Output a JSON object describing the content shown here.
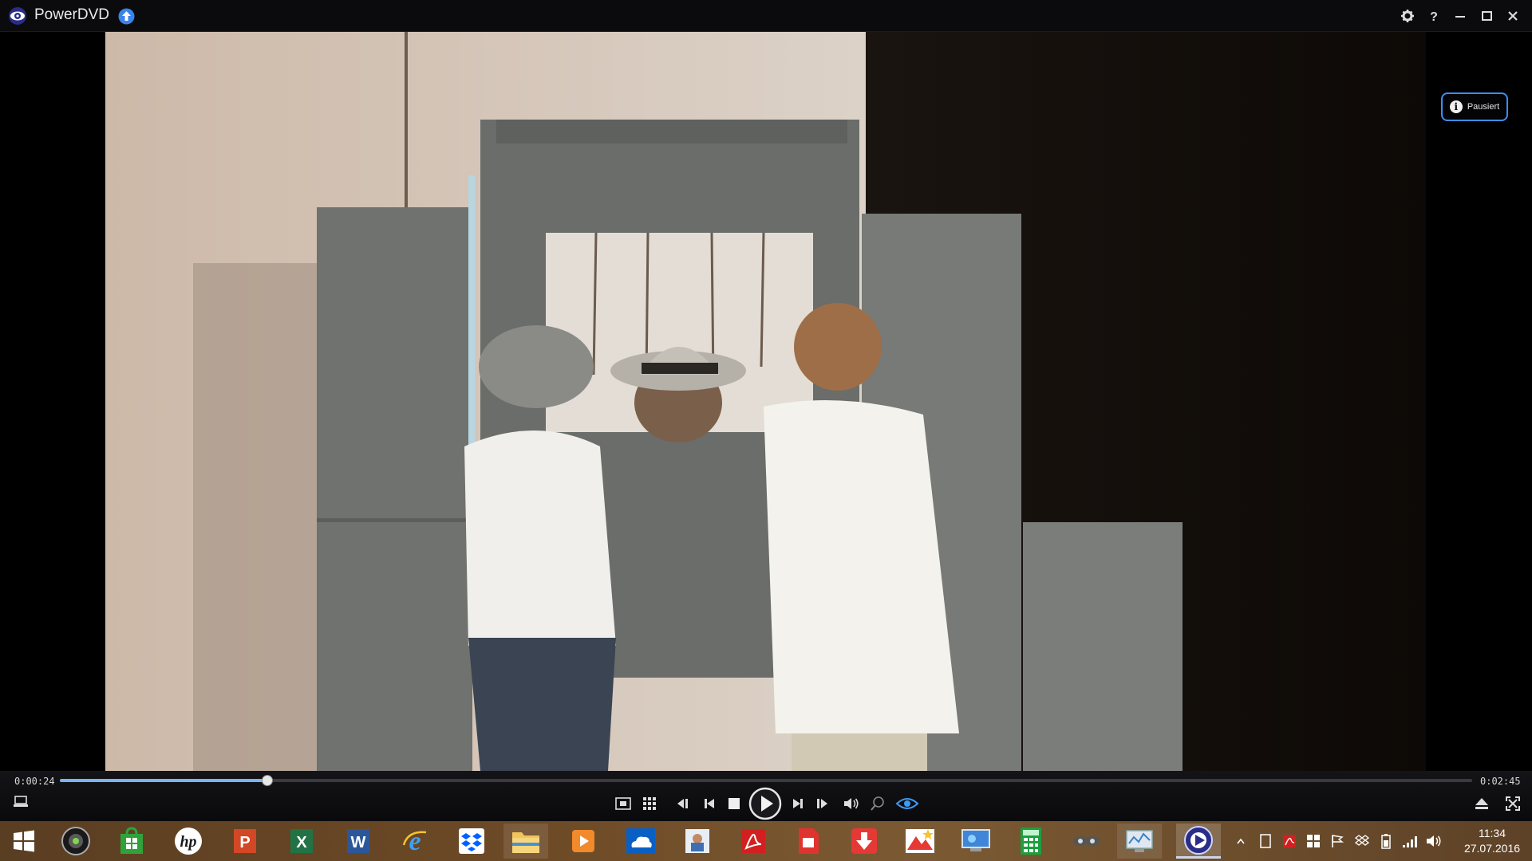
{
  "app": {
    "title": "PowerDVD"
  },
  "playback": {
    "status_label": "Pausiert",
    "current_time": "0:00:24",
    "total_time": "0:02:45",
    "progress": 0.147
  },
  "clock": {
    "time": "11:34",
    "date": "27.07.2016"
  },
  "colors": {
    "accent": "#3d8df3",
    "seek": "#7ab4f5"
  }
}
